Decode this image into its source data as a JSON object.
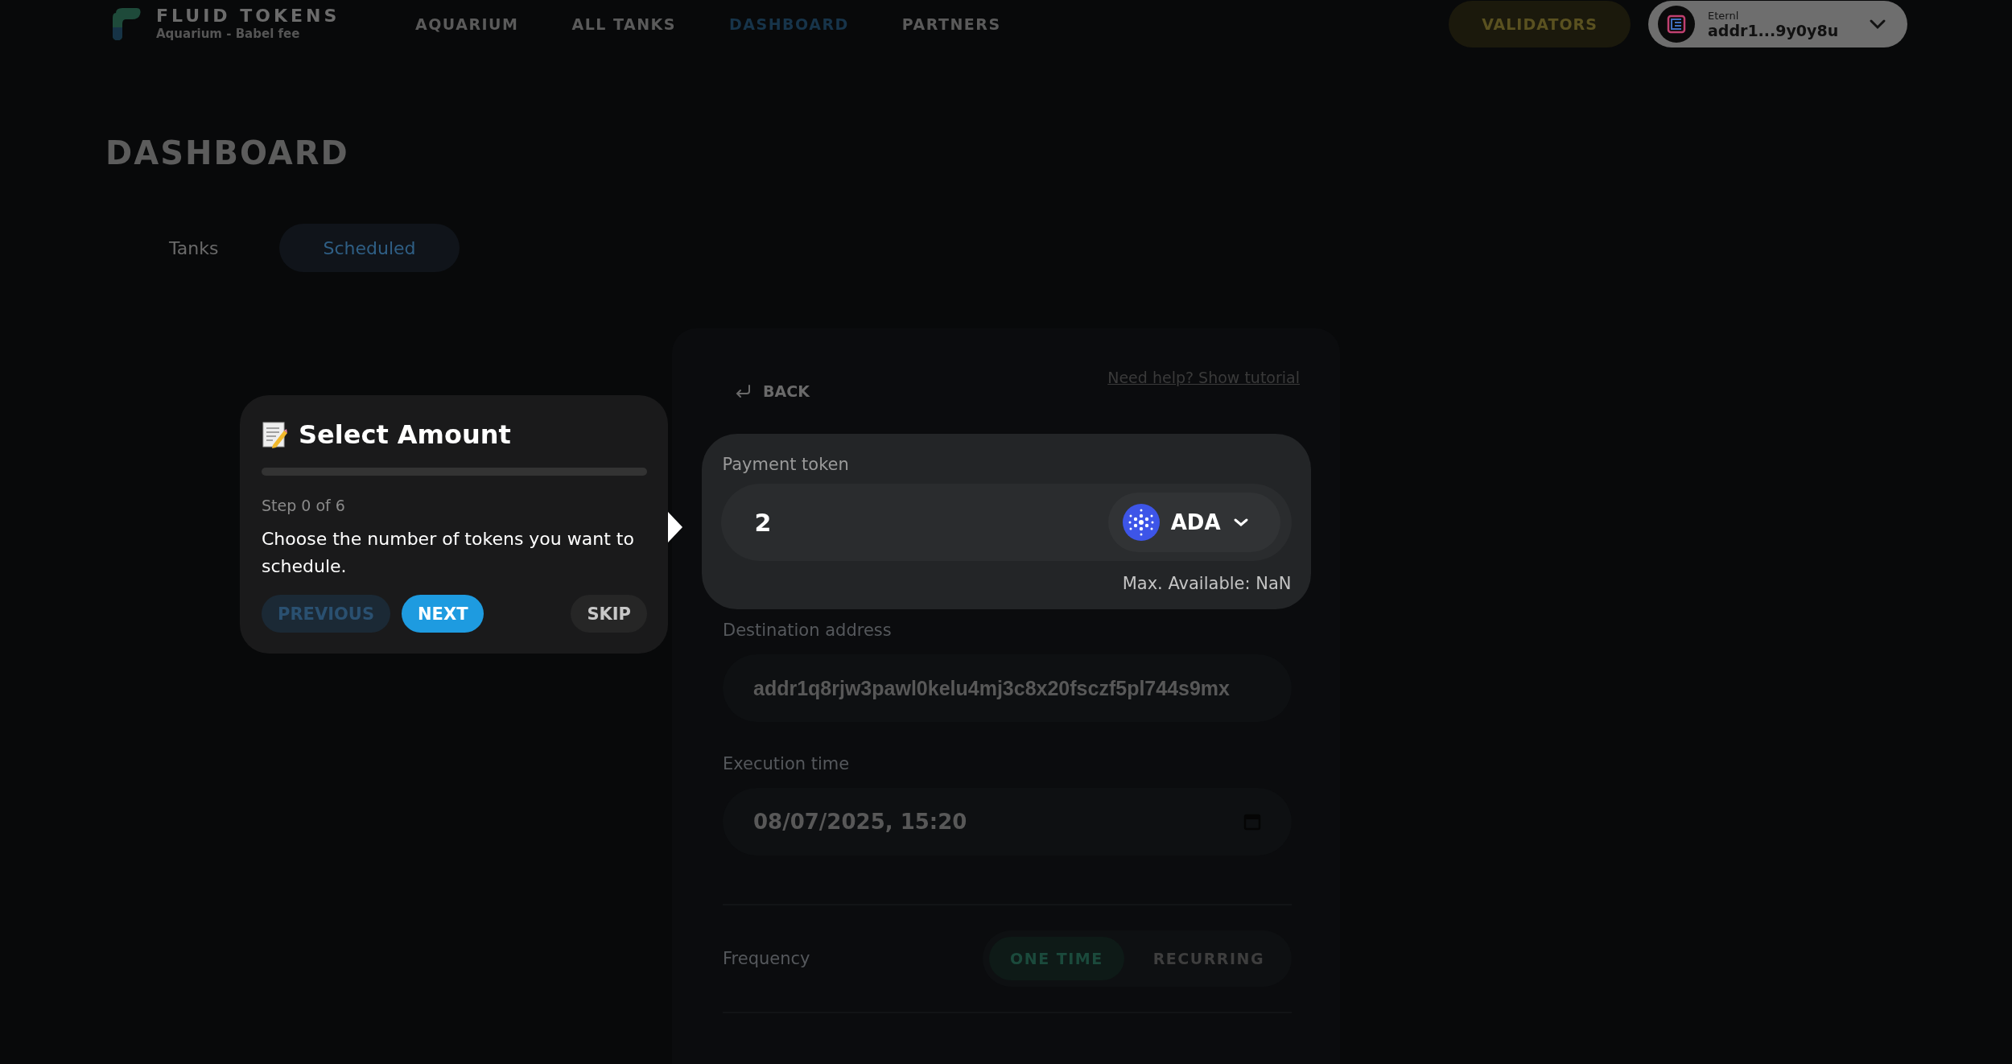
{
  "header": {
    "brand": "FLUID TOKENS",
    "subtitle": "Aquarium - Babel fee",
    "nav": [
      {
        "label": "AQUARIUM",
        "selected": false
      },
      {
        "label": "ALL TANKS",
        "selected": false
      },
      {
        "label": "DASHBOARD",
        "selected": true
      },
      {
        "label": "PARTNERS",
        "selected": false
      }
    ],
    "validators_button": "VALIDATORS",
    "wallet": {
      "name": "Eternl",
      "address": "addr1...9y0y8u"
    }
  },
  "page_title": "DASHBOARD",
  "tabs": [
    {
      "label": "Tanks",
      "selected": false
    },
    {
      "label": "Scheduled",
      "selected": true
    }
  ],
  "form": {
    "back": "BACK",
    "help_link": "Need help? Show tutorial",
    "payment": {
      "label": "Payment token",
      "amount": "2",
      "token": "ADA",
      "max_available": "Max. Available: NaN"
    },
    "destination": {
      "label": "Destination address",
      "value": "addr1q8rjw3pawl0kelu4mj3c8x20fsczf5pl744s9mx"
    },
    "execution": {
      "label": "Execution time",
      "value": "08/07/2025, 15:20"
    },
    "frequency": {
      "label": "Frequency",
      "options": [
        {
          "label": "ONE TIME",
          "selected": true
        },
        {
          "label": "RECURRING",
          "selected": false
        }
      ]
    }
  },
  "tour": {
    "title": "Select Amount",
    "level": 0,
    "step": "Step 0 of 6",
    "text": "Choose the number of tokens you want to schedule.",
    "buttons": [
      {
        "label": "PREVIOUS",
        "kind": "secondary"
      },
      {
        "label": "NEXT",
        "kind": "primary"
      },
      {
        "label": "SKIP",
        "kind": "skip"
      }
    ]
  }
}
